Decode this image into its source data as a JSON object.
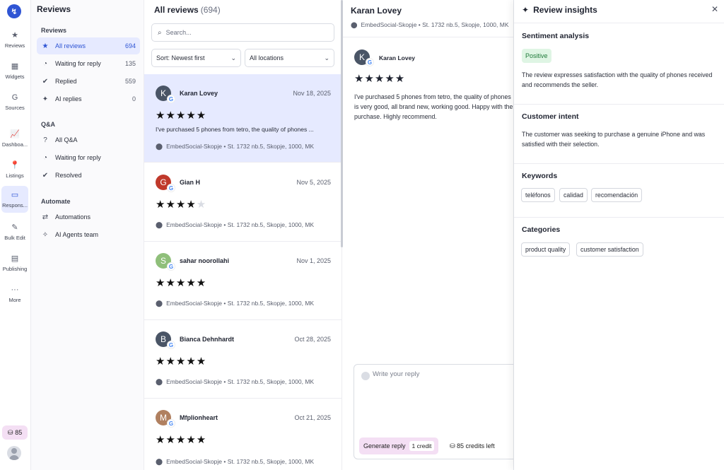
{
  "rail": {
    "logo_letter": "↯",
    "items": [
      {
        "label": "Reviews",
        "icon": "★"
      },
      {
        "label": "Widgets",
        "icon": "▦"
      },
      {
        "label": "Sources",
        "icon": "G"
      },
      {
        "label": "Dashboa...",
        "icon": "📈"
      },
      {
        "label": "Listings",
        "icon": "📍"
      },
      {
        "label": "Respons...",
        "icon": "▭"
      },
      {
        "label": "Bulk Edit",
        "icon": "✎"
      },
      {
        "label": "Publishing",
        "icon": "▤"
      },
      {
        "label": "More",
        "icon": "···"
      }
    ],
    "credits": "85"
  },
  "nav": {
    "title": "Reviews",
    "section_reviews": "Reviews",
    "section_qa": "Q&A",
    "section_automate": "Automate",
    "reviews_items": [
      {
        "label": "All reviews",
        "count": "694",
        "icon": "★"
      },
      {
        "label": "Waiting for reply",
        "count": "135",
        "icon": "◔"
      },
      {
        "label": "Replied",
        "count": "559",
        "icon": "✔"
      },
      {
        "label": "AI replies",
        "count": "0",
        "icon": "✦"
      }
    ],
    "qa_items": [
      {
        "label": "All Q&A",
        "icon": "?"
      },
      {
        "label": "Waiting for reply",
        "icon": "◔"
      },
      {
        "label": "Resolved",
        "icon": "✔"
      }
    ],
    "automate_items": [
      {
        "label": "Automations",
        "icon": "⇄"
      },
      {
        "label": "AI Agents team",
        "icon": "✧"
      }
    ]
  },
  "list": {
    "title": "All reviews",
    "count": "(694)",
    "search_placeholder": "Search...",
    "sort_label": "Sort: Newest first",
    "location_label": "All locations",
    "reviews": [
      {
        "name": "Karan Lovey",
        "date": "Nov 18, 2025",
        "rating": 5,
        "initial": "K",
        "snippet": "I've purchased 5 phones from tetro, the quality of phones ...",
        "location": "EmbedSocial-Skopje",
        "address": "St. 1732 nb.5, Skopje, 1000, MK"
      },
      {
        "name": "Gian H",
        "date": "Nov 5, 2025",
        "rating": 4,
        "initial": "G",
        "snippet": "",
        "location": "EmbedSocial-Skopje",
        "address": "St. 1732 nb.5, Skopje, 1000, MK"
      },
      {
        "name": "sahar noorollahi",
        "date": "Nov 1, 2025",
        "rating": 5,
        "initial": "S",
        "snippet": "",
        "location": "EmbedSocial-Skopje",
        "address": "St. 1732 nb.5, Skopje, 1000, MK"
      },
      {
        "name": "Bianca Dehnhardt",
        "date": "Oct 28, 2025",
        "rating": 5,
        "initial": "B",
        "snippet": "",
        "location": "EmbedSocial-Skopje",
        "address": "St. 1732 nb.5, Skopje, 1000, MK"
      },
      {
        "name": "Mfplionheart",
        "date": "Oct 21, 2025",
        "rating": 5,
        "initial": "M",
        "snippet": "",
        "location": "EmbedSocial-Skopje",
        "address": "St. 1732 nb.5, Skopje, 1000, MK"
      }
    ]
  },
  "detail": {
    "name": "Karan Lovey",
    "location": "EmbedSocial-Skopje",
    "address": "St. 1732 nb.5, Skopje, 1000, MK",
    "initial": "K",
    "rating": 5,
    "text": "I've purchased 5 phones from tetro, the quality of phones is very good, all brand new, working good. Happy with the purchase. Highly recommend.",
    "reply_placeholder": "Write your reply",
    "generate_label": "Generate reply",
    "credit_cost": "1 credit",
    "credits_left": "85 credits left"
  },
  "insights": {
    "title": "Review insights",
    "sentiment_title": "Sentiment analysis",
    "sentiment_value": "Positive",
    "sentiment_text": "The review expresses satisfaction with the quality of phones received and recommends the seller.",
    "intent_title": "Customer intent",
    "intent_text": "The customer was seeking to purchase a genuine iPhone and was satisfied with their selection.",
    "keywords_title": "Keywords",
    "keywords": [
      "teléfonos",
      "calidad",
      "recomendación"
    ],
    "categories_title": "Categories",
    "categories": [
      "product quality",
      "customer satisfaction"
    ]
  },
  "colors": {
    "accent": "#2f55d4",
    "selected_bg": "#e6eaff",
    "positive_bg": "#dff5e4",
    "credits_bg": "#f4dff4"
  }
}
